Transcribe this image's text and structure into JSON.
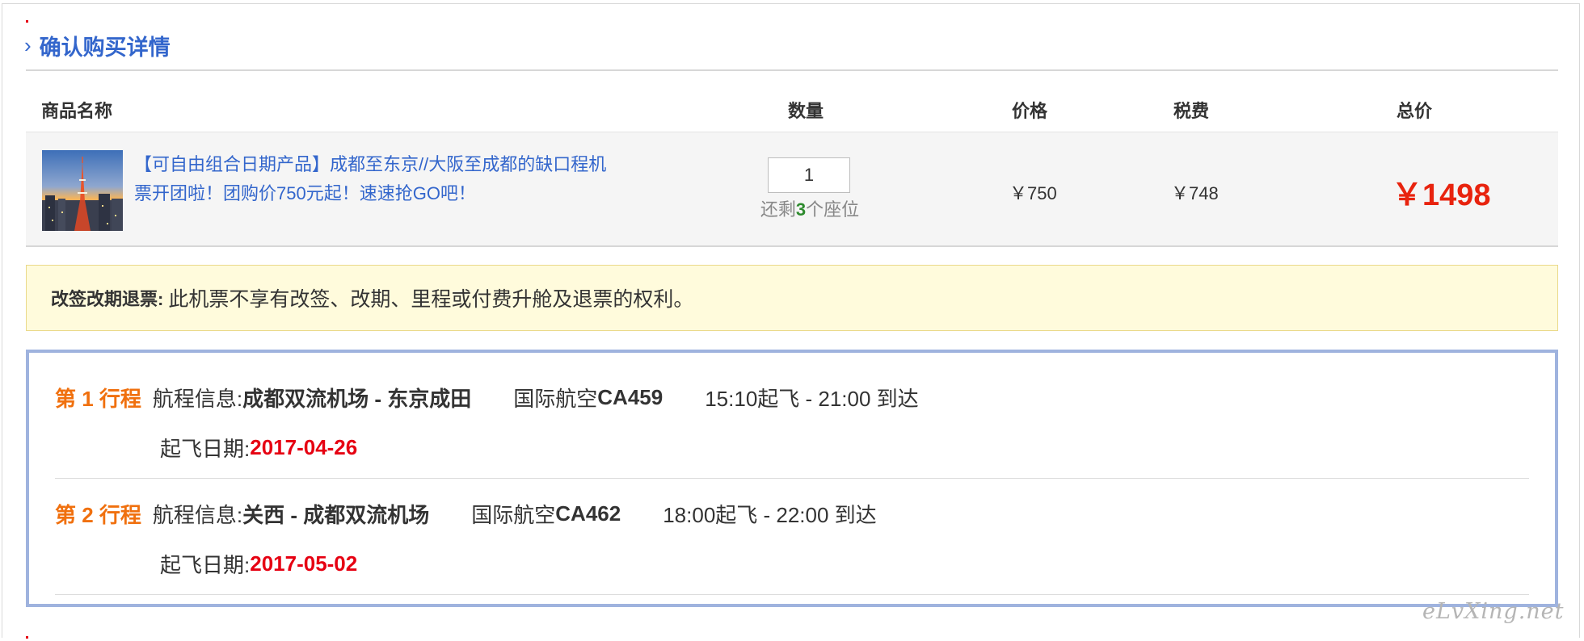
{
  "section": {
    "title": "确认购买详情"
  },
  "columns": {
    "name": "商品名称",
    "quantity": "数量",
    "price": "价格",
    "tax": "税费",
    "total": "总价"
  },
  "product": {
    "name_line1": "【可自由组合日期产品】成都至东京//大阪至成都的缺口程机",
    "name_line2": "票开团啦！团购价750元起！速速抢GO吧！",
    "quantity": "1",
    "seats_prefix": "还剩",
    "seats_count": "3",
    "seats_suffix": "个座位",
    "price": "￥750",
    "tax": "￥748",
    "total": "￥1498"
  },
  "notice": {
    "label": "改签改期退票:",
    "text": "此机票不享有改签、改期、里程或付费升舱及退票的权利。"
  },
  "legs": [
    {
      "label": "第 1 行程",
      "info_prefix": "航程信息:",
      "route": "成都双流机场 - 东京成田",
      "airline_prefix": "国际航空",
      "flight": "CA459",
      "times": "15:10起飞 - 21:00 到达",
      "date_label": "起飞日期:",
      "date": "2017-04-26"
    },
    {
      "label": "第 2 行程",
      "info_prefix": "航程信息:",
      "route": "关西 - 成都双流机场",
      "airline_prefix": "国际航空",
      "flight": "CA462",
      "times": "18:00起飞 - 22:00 到达",
      "date_label": "起飞日期:",
      "date": "2017-05-02"
    }
  ],
  "watermark": "eLvXing.net",
  "colors": {
    "link": "#3366cc",
    "total": "#e8230e",
    "leg_label": "#f0700e",
    "date": "#e60012",
    "notice_bg": "#fffbdc",
    "itinerary_border": "#9fb3de"
  }
}
